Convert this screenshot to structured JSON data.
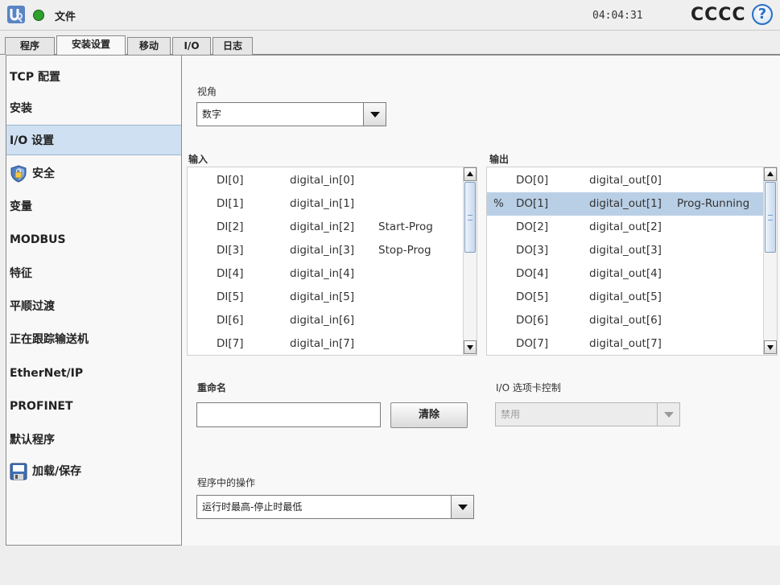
{
  "topbar": {
    "file_menu": "文件",
    "time": "04:04:31",
    "robot_name": "CCCC",
    "help_glyph": "?",
    "status_color": "#2ea02e"
  },
  "tabs": [
    "程序",
    "安装设置",
    "移动",
    "I/O",
    "日志"
  ],
  "active_tab": "安装设置",
  "sidebar": {
    "items": [
      {
        "label": "TCP 配置"
      },
      {
        "label": "安装"
      },
      {
        "label": "I/O 设置",
        "selected": true
      },
      {
        "label": "安全",
        "icon": "shield-icon"
      },
      {
        "label": "变量"
      },
      {
        "label": "MODBUS"
      },
      {
        "label": "特征"
      },
      {
        "label": "平顺过渡"
      },
      {
        "label": "正在跟踪输送机"
      },
      {
        "label": "EtherNet/IP"
      },
      {
        "label": "PROFINET"
      },
      {
        "label": "默认程序"
      },
      {
        "label": "加载/保存",
        "icon": "floppy-disk-icon"
      }
    ]
  },
  "main": {
    "view_label": "视角",
    "view_value": "数字",
    "inputs_label": "输入",
    "outputs_label": "输出",
    "inputs": [
      {
        "marker": "",
        "id": "DI[0]",
        "name": "digital_in[0]",
        "alias": ""
      },
      {
        "marker": "",
        "id": "DI[1]",
        "name": "digital_in[1]",
        "alias": ""
      },
      {
        "marker": "",
        "id": "DI[2]",
        "name": "digital_in[2]",
        "alias": "Start-Prog"
      },
      {
        "marker": "",
        "id": "DI[3]",
        "name": "digital_in[3]",
        "alias": "Stop-Prog"
      },
      {
        "marker": "",
        "id": "DI[4]",
        "name": "digital_in[4]",
        "alias": ""
      },
      {
        "marker": "",
        "id": "DI[5]",
        "name": "digital_in[5]",
        "alias": ""
      },
      {
        "marker": "",
        "id": "DI[6]",
        "name": "digital_in[6]",
        "alias": ""
      },
      {
        "marker": "",
        "id": "DI[7]",
        "name": "digital_in[7]",
        "alias": ""
      }
    ],
    "outputs": [
      {
        "marker": "",
        "id": "DO[0]",
        "name": "digital_out[0]",
        "alias": ""
      },
      {
        "marker": "%",
        "id": "DO[1]",
        "name": "digital_out[1]",
        "alias": "Prog-Running",
        "selected": true
      },
      {
        "marker": "",
        "id": "DO[2]",
        "name": "digital_out[2]",
        "alias": ""
      },
      {
        "marker": "",
        "id": "DO[3]",
        "name": "digital_out[3]",
        "alias": ""
      },
      {
        "marker": "",
        "id": "DO[4]",
        "name": "digital_out[4]",
        "alias": ""
      },
      {
        "marker": "",
        "id": "DO[5]",
        "name": "digital_out[5]",
        "alias": ""
      },
      {
        "marker": "",
        "id": "DO[6]",
        "name": "digital_out[6]",
        "alias": ""
      },
      {
        "marker": "",
        "id": "DO[7]",
        "name": "digital_out[7]",
        "alias": ""
      }
    ],
    "rename_label": "重命名",
    "rename_value": "",
    "clear_button": "清除",
    "tab_control_label": "I/O 选项卡控制",
    "tab_control_value": "禁用",
    "program_action_label": "程序中的操作",
    "program_action_value": "运行时最高-停止时最低"
  }
}
